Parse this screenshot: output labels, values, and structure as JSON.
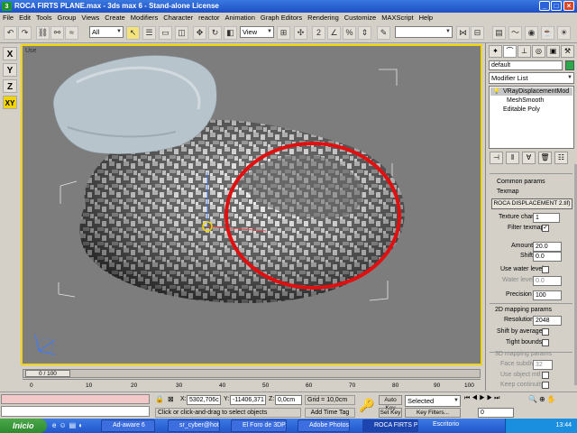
{
  "window": {
    "title": "ROCA FIRTS PLANE.max - 3ds max 6 - Stand-alone License"
  },
  "menu": [
    "File",
    "Edit",
    "Tools",
    "Group",
    "Views",
    "Create",
    "Modifiers",
    "Character",
    "reactor",
    "Animation",
    "Graph Editors",
    "Rendering",
    "Customize",
    "MAXScript",
    "Help"
  ],
  "toolbar": {
    "selection_filter": "All",
    "ref_coord": "View"
  },
  "viewport": {
    "label": "Use"
  },
  "axis_buttons": [
    "X",
    "Y",
    "Z",
    "XY"
  ],
  "command_panel": {
    "object_name": "default",
    "modifier_list": "Modifier List",
    "stack": [
      "VRayDisplacementMod",
      "MeshSmooth",
      "Editable Poly"
    ],
    "section_common": "Common params",
    "texmap_label": "Texmap",
    "texmap_value": "ROCA DISPLACEMENT 2.tif)",
    "texture_chan_label": "Texture chan",
    "texture_chan_value": "1",
    "filter_texmap_label": "Filter texmap",
    "amount_label": "Amount",
    "amount_value": "20.0",
    "shift_label": "Shift",
    "shift_value": "0.0",
    "use_water_label": "Use water level",
    "water_level_label": "Water level",
    "water_level_value": "0.0",
    "precision_label": "Precision",
    "precision_value": "100",
    "section_2d": "2D mapping params",
    "resolution_label": "Resolution",
    "resolution_value": "2048",
    "shift_avg_label": "Shift by average",
    "tight_bounds_label": "Tight bounds",
    "section_3d": "3D mapping params",
    "face_subdivs_label": "Face subdivs",
    "face_subdivs_value": "32",
    "use_object_mtl_label": "Use object mtl",
    "keep_continuity_label": "Keep continuity"
  },
  "timeline": {
    "frame": "0 / 100",
    "ticks": [
      "0",
      "10",
      "20",
      "30",
      "40",
      "50",
      "60",
      "70",
      "80",
      "90",
      "100"
    ]
  },
  "status": {
    "x_value": "5302,706c",
    "y_value": "-11406,371",
    "z_value": "0,0cm",
    "grid": "Grid = 10,0cm",
    "prompt": "Click or click-and-drag to select objects",
    "add_time_tag": "Add Time Tag",
    "auto_key": "Auto Key",
    "set_key": "Set Key",
    "selected": "Selected",
    "key_filters": "Key Filters...",
    "frame_field": "0"
  },
  "taskbar": {
    "start": "Inicio",
    "tasks": [
      "Ad-aware 6",
      "sr_cyber@hot...",
      "El Foro de 3DP...",
      "Adobe Photos...",
      "ROCA FIRTS P...",
      "Escritorio"
    ],
    "clock": "13:44"
  },
  "colors": {
    "selection_circle": "#e01010",
    "viewport_border": "#f2d400"
  }
}
